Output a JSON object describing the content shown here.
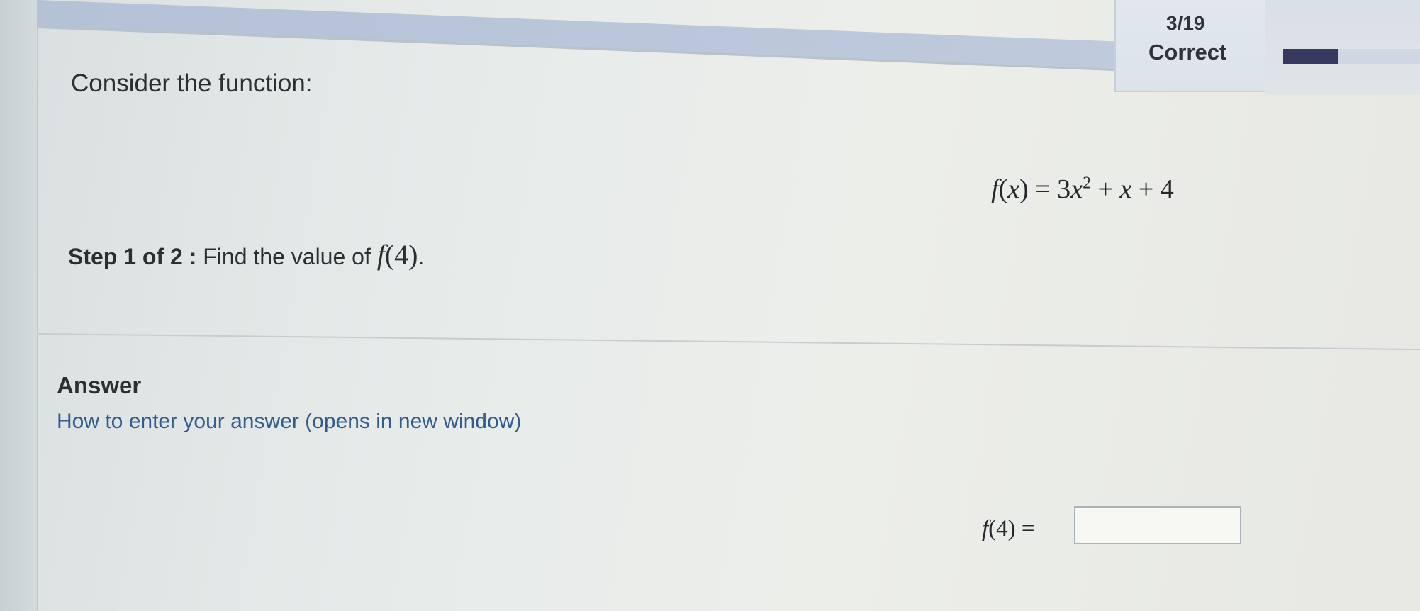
{
  "progress": {
    "count": "3/19",
    "status": "Correct",
    "fraction": 0.4
  },
  "question": {
    "intro": "Consider the function:",
    "function_lhs": "f",
    "function_var": "x",
    "function_rhs_a": "= 3",
    "function_rhs_exp": "2",
    "function_rhs_b": "+ ",
    "function_rhs_var": "x",
    "function_rhs_c": " + 4",
    "step_label": "Step 1 of 2 :",
    "step_text": "Find the value of",
    "step_fn": "f",
    "step_arg": "(4)",
    "step_end": "."
  },
  "answer": {
    "heading": "Answer",
    "help_link": "How to enter your answer (opens in new window)",
    "label_fn": "f",
    "label_arg": "(4) =",
    "value": ""
  },
  "colors": {
    "progress_fill": "#35385f",
    "link": "#335c8c"
  }
}
